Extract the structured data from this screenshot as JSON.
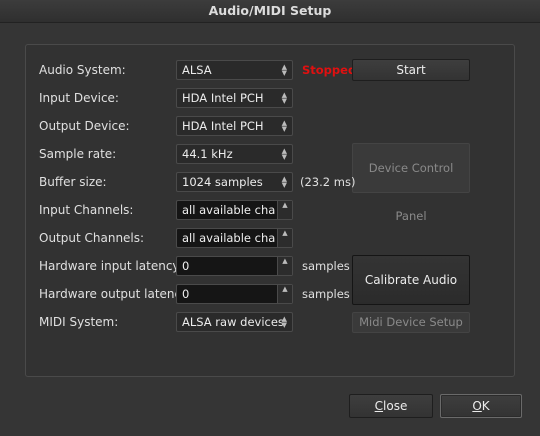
{
  "window": {
    "title": "Audio/MIDI Setup"
  },
  "labels": {
    "audio_system": "Audio System:",
    "input_device": "Input Device:",
    "output_device": "Output Device:",
    "sample_rate": "Sample rate:",
    "buffer_size": "Buffer size:",
    "input_channels": "Input Channels:",
    "output_channels": "Output Channels:",
    "hw_input_latency": "Hardware input latency:",
    "hw_output_latency": "Hardware output latency:",
    "midi_system": "MIDI System:"
  },
  "values": {
    "audio_system": "ALSA",
    "input_device": "HDA Intel PCH",
    "output_device": "HDA Intel PCH",
    "sample_rate": "44.1 kHz",
    "buffer_size": "1024 samples",
    "buffer_ms": "(23.2 ms)",
    "input_channels": "all available channels",
    "output_channels": "all available channels",
    "hw_input_latency": "0",
    "hw_output_latency": "0",
    "latency_unit": "samples",
    "midi_system": "ALSA raw devices"
  },
  "status": {
    "text": "Stopped",
    "color": "#e01010"
  },
  "buttons": {
    "start": "Start",
    "device_control_panel": "Device Control Panel",
    "calibrate_audio": "Calibrate Audio",
    "midi_device_setup": "Midi Device Setup",
    "close_first": "C",
    "close_rest": "lose",
    "ok_first": "O",
    "ok_rest": "K"
  },
  "icons": {
    "combo_arrows": "up-down-chevron-icon",
    "spin_arrows": "stepper-icon"
  }
}
